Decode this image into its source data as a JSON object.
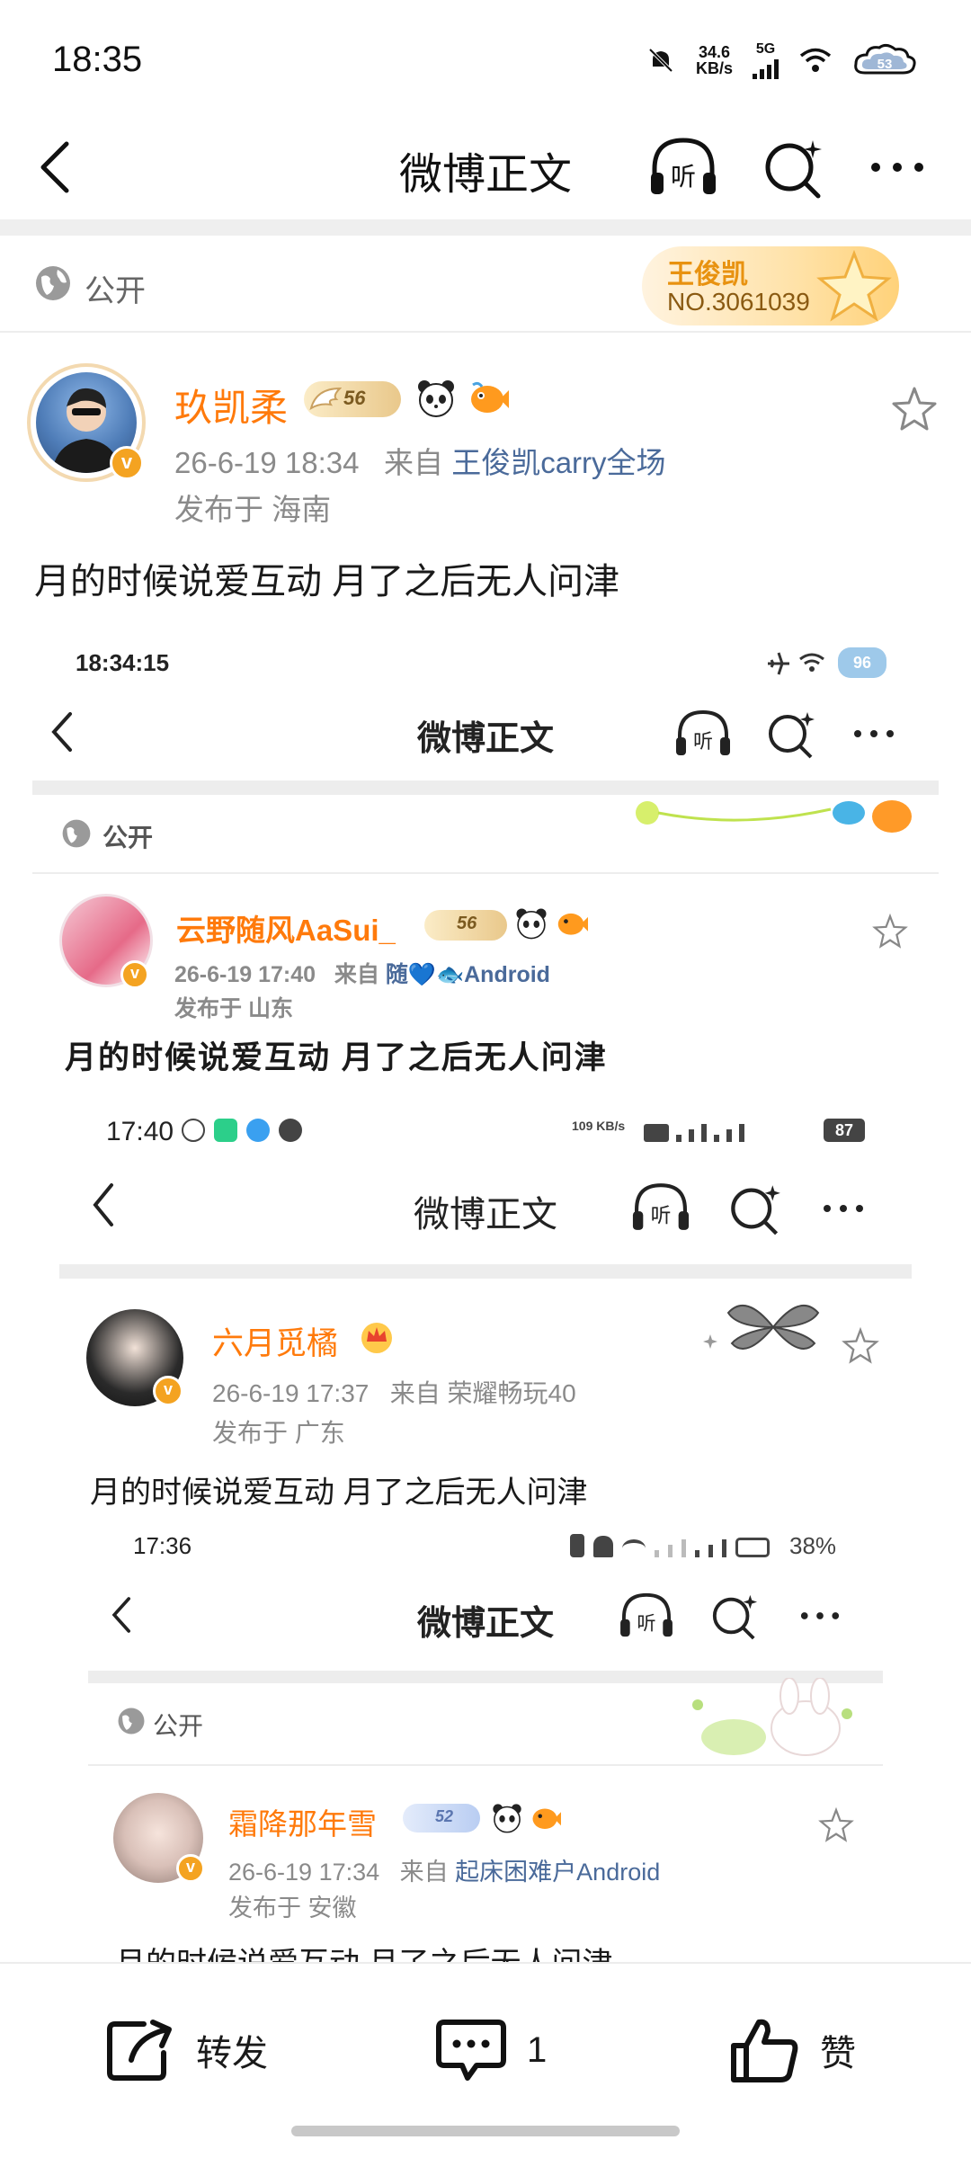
{
  "status_bar": {
    "time": "18:35",
    "net_speed_value": "34.6",
    "net_speed_unit": "KB/s",
    "network": "5G",
    "battery": "53"
  },
  "nav": {
    "title": "微博正文",
    "listen_label": "听"
  },
  "visibility": {
    "label": "公开"
  },
  "fan_badge": {
    "name": "王俊凯",
    "number": "NO.3061039"
  },
  "post": {
    "author": "玖凯柔",
    "level": "56",
    "date": "26-6-19 18:34",
    "from_label": "来自",
    "source": "王俊凯carry全场",
    "location_label": "发布于",
    "location": "海南",
    "text": "月的时候说爱互动 月了之后无人问津"
  },
  "embedded_1": {
    "time": "18:34:15",
    "battery": "96",
    "nav_title": "微博正文",
    "listen_label": "听",
    "visibility": "公开",
    "author": "云野随风AaSui_",
    "level": "56",
    "date": "26-6-19 17:40",
    "from_label": "来自",
    "source": "随💙🐟Android",
    "location_label": "发布于",
    "location": "山东",
    "text": "月的时候说爱互动 月了之后无人问津"
  },
  "embedded_2": {
    "time": "17:40",
    "net_speed": "109 KB/s",
    "battery": "87",
    "nav_title": "微博正文",
    "listen_label": "听",
    "author": "六月觅橘",
    "date": "26-6-19 17:37",
    "from_label": "来自",
    "source": "荣耀畅玩40",
    "location_label": "发布于",
    "location": "广东",
    "text": "月的时候说爱互动 月了之后无人问津"
  },
  "embedded_3": {
    "time": "17:36",
    "battery": "38%",
    "nav_title": "微博正文",
    "listen_label": "听",
    "visibility": "公开",
    "author": "霜降那年雪",
    "level": "52",
    "date": "26-6-19 17:34",
    "from_label": "来自",
    "source": "起床困难户Android",
    "location_label": "发布于",
    "location": "安徽",
    "text": "月的时候说爱互动 月了之后无人问津"
  },
  "bottom_bar": {
    "repost_label": "转发",
    "comment_count": "1",
    "like_label": "赞"
  }
}
